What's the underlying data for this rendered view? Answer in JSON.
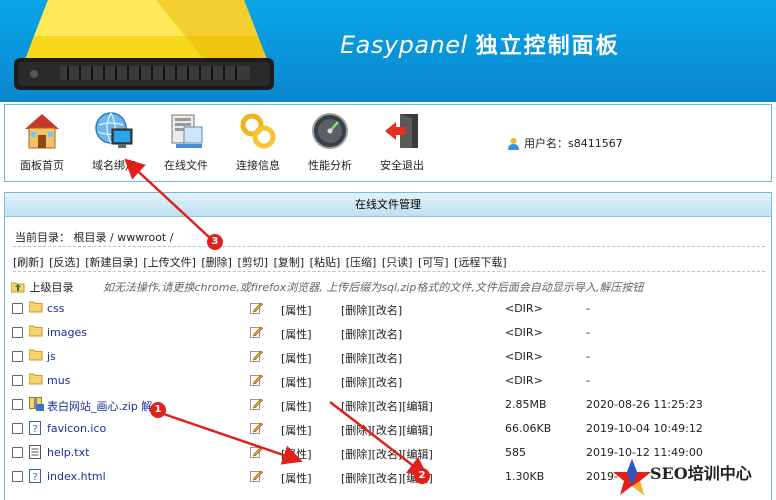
{
  "banner": {
    "title_en": "Easypanel",
    "title_cn": "独立控制面板"
  },
  "nav": {
    "items": [
      {
        "label": "面板首页",
        "icon": "house-icon"
      },
      {
        "label": "域名绑定",
        "icon": "globe-monitor-icon"
      },
      {
        "label": "在线文件",
        "icon": "file-server-icon"
      },
      {
        "label": "连接信息",
        "icon": "link-chain-icon"
      },
      {
        "label": "性能分析",
        "icon": "gauge-icon"
      },
      {
        "label": "安全退出",
        "icon": "exit-door-icon"
      }
    ],
    "user_label": "用户名：",
    "username": "s8411567"
  },
  "panel": {
    "title": "在线文件管理",
    "current_dir_label": "当前目录：",
    "breadcrumb": [
      "根目录",
      "wwwroot"
    ],
    "toolbar": [
      "[刷新]",
      "[反选]",
      "[新建目录]",
      "[上传文件]",
      "[删除]",
      "[剪切]",
      "[复制]",
      "[粘贴]",
      "[压缩]",
      "[只读]",
      "[可写]",
      "[远程下载]"
    ],
    "updir_label": "上级目录",
    "hint": "如无法操作,请更换chrome,或firefox浏览器, 上传后缀为sql,zip格式的文件,文件后面会自动显示导入,解压按钮",
    "attr_label": "[属性]",
    "delete_label": "[删除]",
    "rename_label": "[改名]",
    "edit_label": "[编辑]",
    "files": [
      {
        "name": "css",
        "type": "folder",
        "size": "<DIR>",
        "date": "-",
        "editable": false
      },
      {
        "name": "images",
        "type": "folder",
        "size": "<DIR>",
        "date": "-",
        "editable": false
      },
      {
        "name": "js",
        "type": "folder",
        "size": "<DIR>",
        "date": "-",
        "editable": false
      },
      {
        "name": "mus",
        "type": "folder",
        "size": "<DIR>",
        "date": "-",
        "editable": false
      },
      {
        "name": "表白网站_画心.zip 解",
        "type": "zip",
        "size": "2.85MB",
        "date": "2020-08-26 11:25:23",
        "editable": true
      },
      {
        "name": "favicon.ico",
        "type": "unknown",
        "size": "66.06KB",
        "date": "2019-10-04 10:49:12",
        "editable": true
      },
      {
        "name": "help.txt",
        "type": "text",
        "size": "585",
        "date": "2019-10-12 11:49:00",
        "editable": true
      },
      {
        "name": "index.html",
        "type": "unknown",
        "size": "1.30KB",
        "date": "2019-",
        "editable": true
      }
    ]
  },
  "annotations": [
    "3",
    "1",
    "2"
  ],
  "watermark": {
    "text": "SEO培训中心"
  },
  "colors": {
    "banner_blue": "#0a97dc",
    "panel_border": "#7bb7dd",
    "arrow_red": "#e0201a",
    "link_blue": "#1a2fa3"
  }
}
